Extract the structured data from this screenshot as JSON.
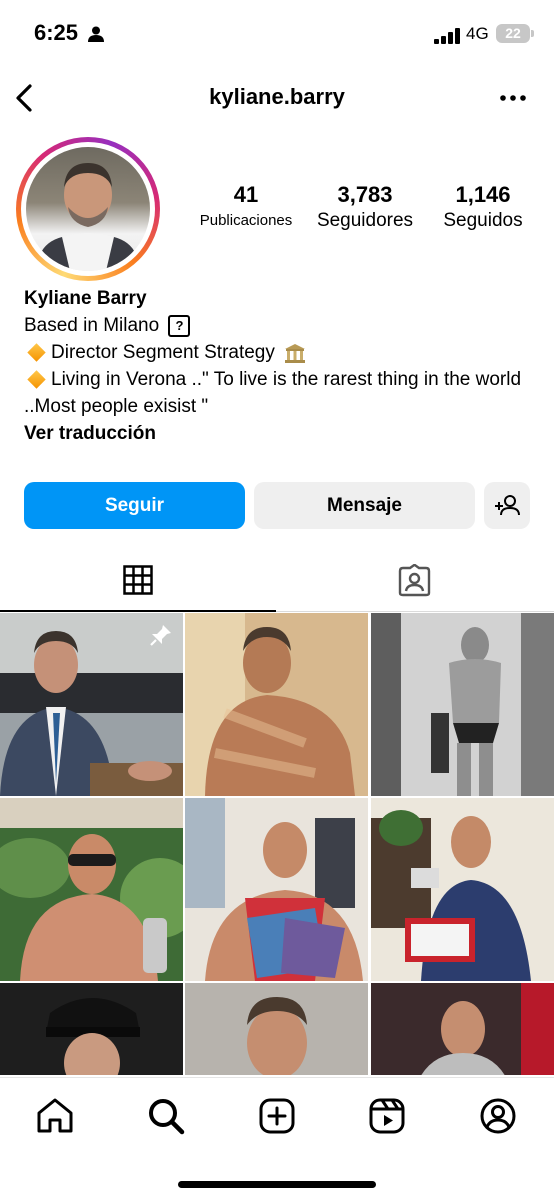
{
  "status_bar": {
    "time": "6:25",
    "network": "4G",
    "battery": "22"
  },
  "nav": {
    "username": "kyliane.barry"
  },
  "profile": {
    "stats": [
      {
        "count": "41",
        "label": "Publicaciones"
      },
      {
        "count": "3,783",
        "label": "Seguidores"
      },
      {
        "count": "1,146",
        "label": "Seguidos"
      }
    ],
    "display_name": "Kyliane Barry",
    "bio_line1": "Based in Milano",
    "bio_help_glyph": "?",
    "bio_line2": "Director Segment Strategy",
    "bio_line3": "Living in Verona ..\" To live is the rarest thing in the world ..Most people exisist \"",
    "translate_link": "Ver traducción"
  },
  "actions": {
    "follow": "Seguir",
    "message": "Mensaje"
  },
  "icons": [
    "back-chevron-icon",
    "more-options-icon",
    "add-person-icon",
    "grid-icon",
    "tagged-icon",
    "pin-icon",
    "home-icon",
    "search-icon",
    "create-post-icon",
    "reels-icon",
    "profile-icon"
  ],
  "colors": {
    "accent": "#0095f6",
    "button_gray": "#efefef"
  }
}
